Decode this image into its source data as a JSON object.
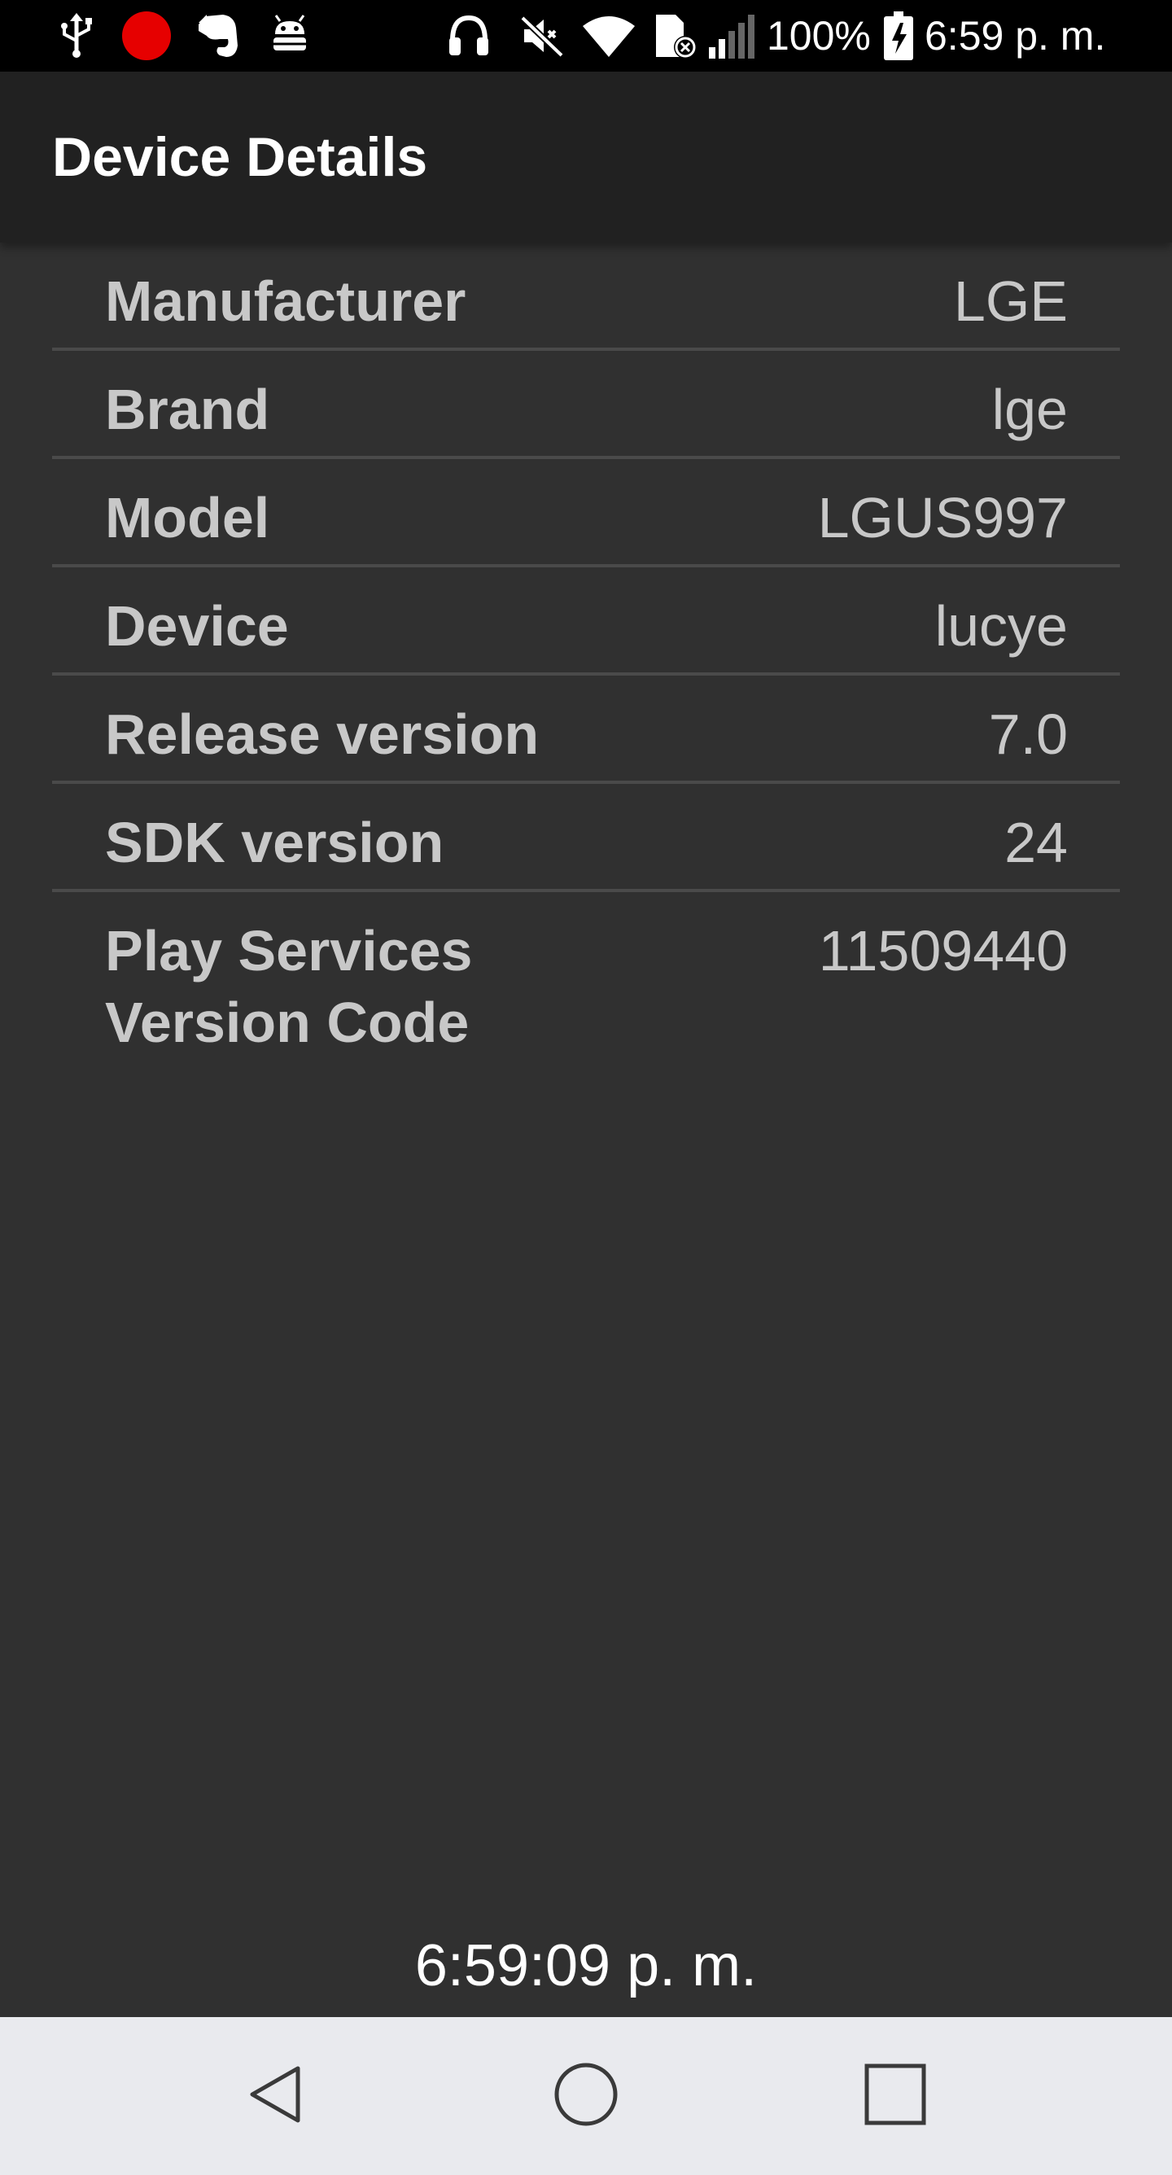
{
  "status_bar": {
    "battery": "100%",
    "time": "6:59 p. m."
  },
  "app_bar": {
    "title": "Device Details"
  },
  "details": [
    {
      "label": "Manufacturer",
      "value": "LGE"
    },
    {
      "label": "Brand",
      "value": "lge"
    },
    {
      "label": "Model",
      "value": "LGUS997"
    },
    {
      "label": "Device",
      "value": "lucye"
    },
    {
      "label": "Release version",
      "value": "7.0"
    },
    {
      "label": "SDK version",
      "value": "24"
    },
    {
      "label": "Play Services Version Code",
      "value": "11509440"
    }
  ],
  "clock": "6:59:09 p. m.",
  "icons": {
    "status_left": [
      "usb-icon",
      "recording-dot-icon",
      "evernote-icon",
      "android-debug-icon"
    ],
    "status_right": [
      "headphones-icon",
      "vibrate-off-icon",
      "wifi-icon",
      "no-sim-icon",
      "signal-icon",
      "battery-charging-icon"
    ],
    "nav": [
      "back-icon",
      "home-icon",
      "recents-icon"
    ]
  },
  "colors": {
    "background": "#303030",
    "app_bar": "#212121",
    "status_bar": "#000000",
    "nav_bar": "#e9eaee",
    "recording_dot": "#e60000"
  }
}
